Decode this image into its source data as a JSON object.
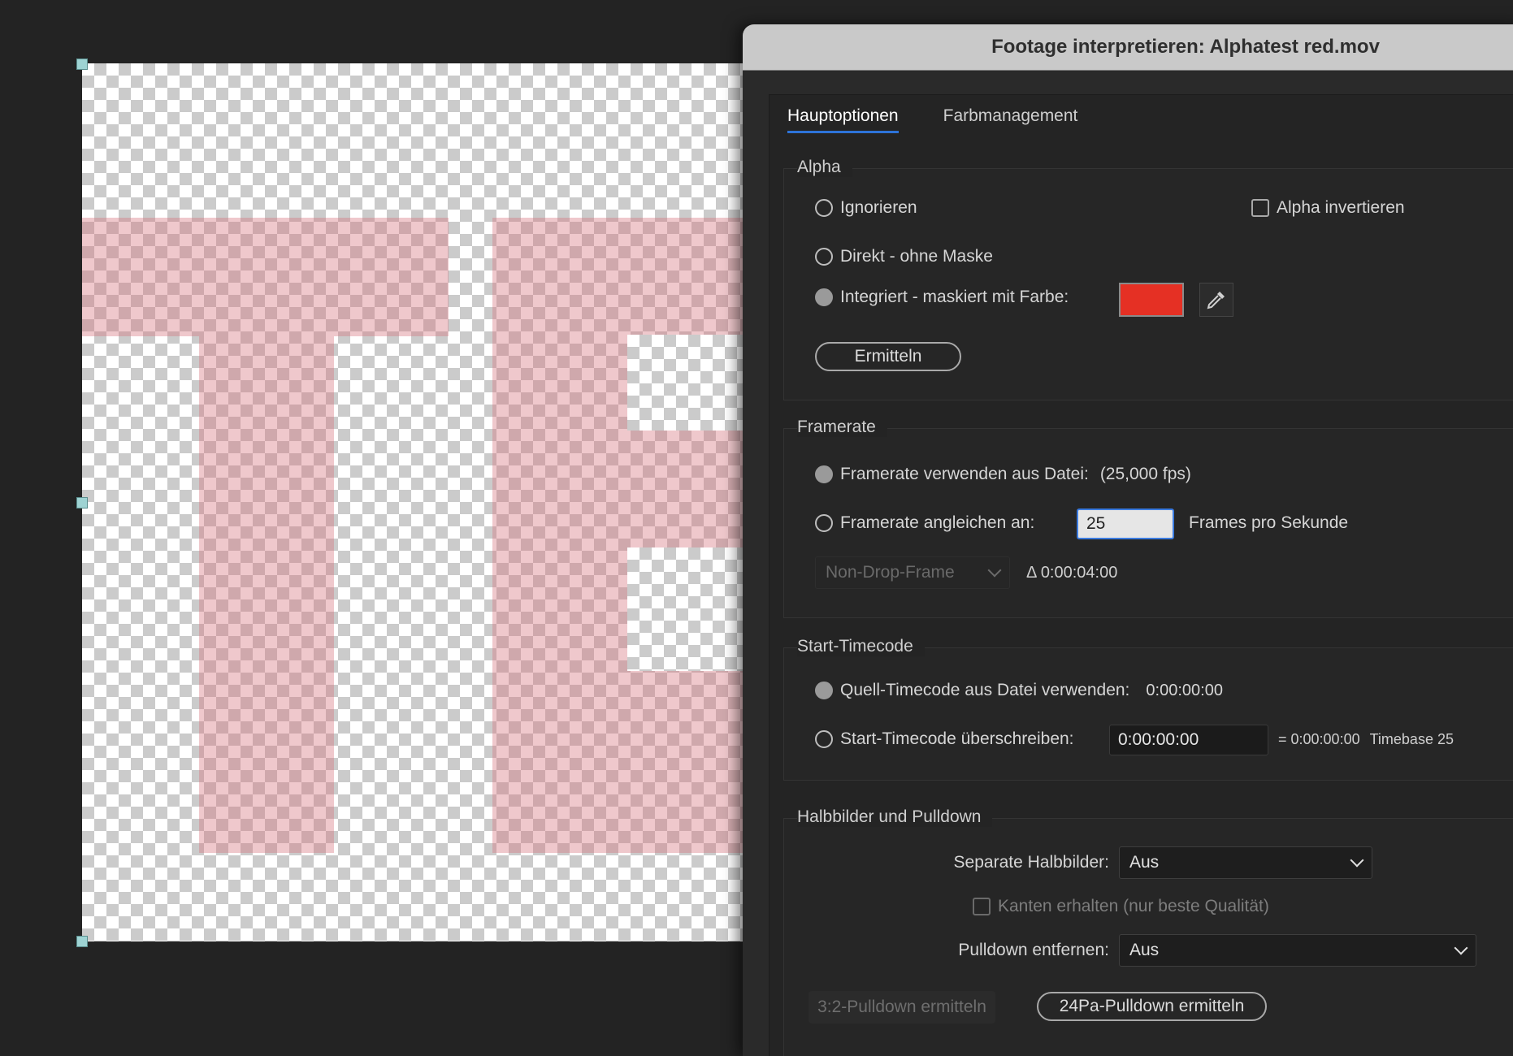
{
  "dialog": {
    "title": "Footage interpretieren: Alphatest red.mov",
    "tabs": [
      "Hauptoptionen",
      "Farbmanagement"
    ]
  },
  "alpha": {
    "title": "Alpha",
    "ignore": "Ignorieren",
    "invert": "Alpha invertieren",
    "straight": "Direkt - ohne Maske",
    "premultiplied": "Integriert - maskiert mit Farbe:",
    "matte_color": "#e53024",
    "guess_button": "Ermitteln",
    "selected": "premultiplied"
  },
  "framerate": {
    "title": "Framerate",
    "from_file_label": "Framerate verwenden aus Datei:",
    "from_file_value": "(25,000 fps)",
    "conform_label": "Framerate angleichen an:",
    "conform_value": "25",
    "unit": "Frames pro Sekunde",
    "drop_frame": "Non-Drop-Frame",
    "duration": "Δ 0:00:04:00"
  },
  "timecode": {
    "title": "Start-Timecode",
    "source_label": "Quell-Timecode aus Datei verwenden:",
    "source_value": "0:00:00:00",
    "override_label": "Start-Timecode überschreiben:",
    "override_value": "0:00:00:00",
    "equals": "= 0:00:00:00",
    "timebase": "Timebase 25"
  },
  "fields": {
    "title": "Halbbilder und Pulldown",
    "separate_label": "Separate Halbbilder:",
    "separate_value": "Aus",
    "preserve_edges": "Kanten erhalten (nur beste Qualität)",
    "pulldown_label": "Pulldown entfernen:",
    "pulldown_value": "Aus",
    "guess_32": "3:2-Pulldown ermitteln",
    "guess_24pa": "24Pa-Pulldown ermitteln"
  },
  "icons": {
    "eyedropper": "eyedropper-icon",
    "dropdown": "chevron-down-icon"
  }
}
